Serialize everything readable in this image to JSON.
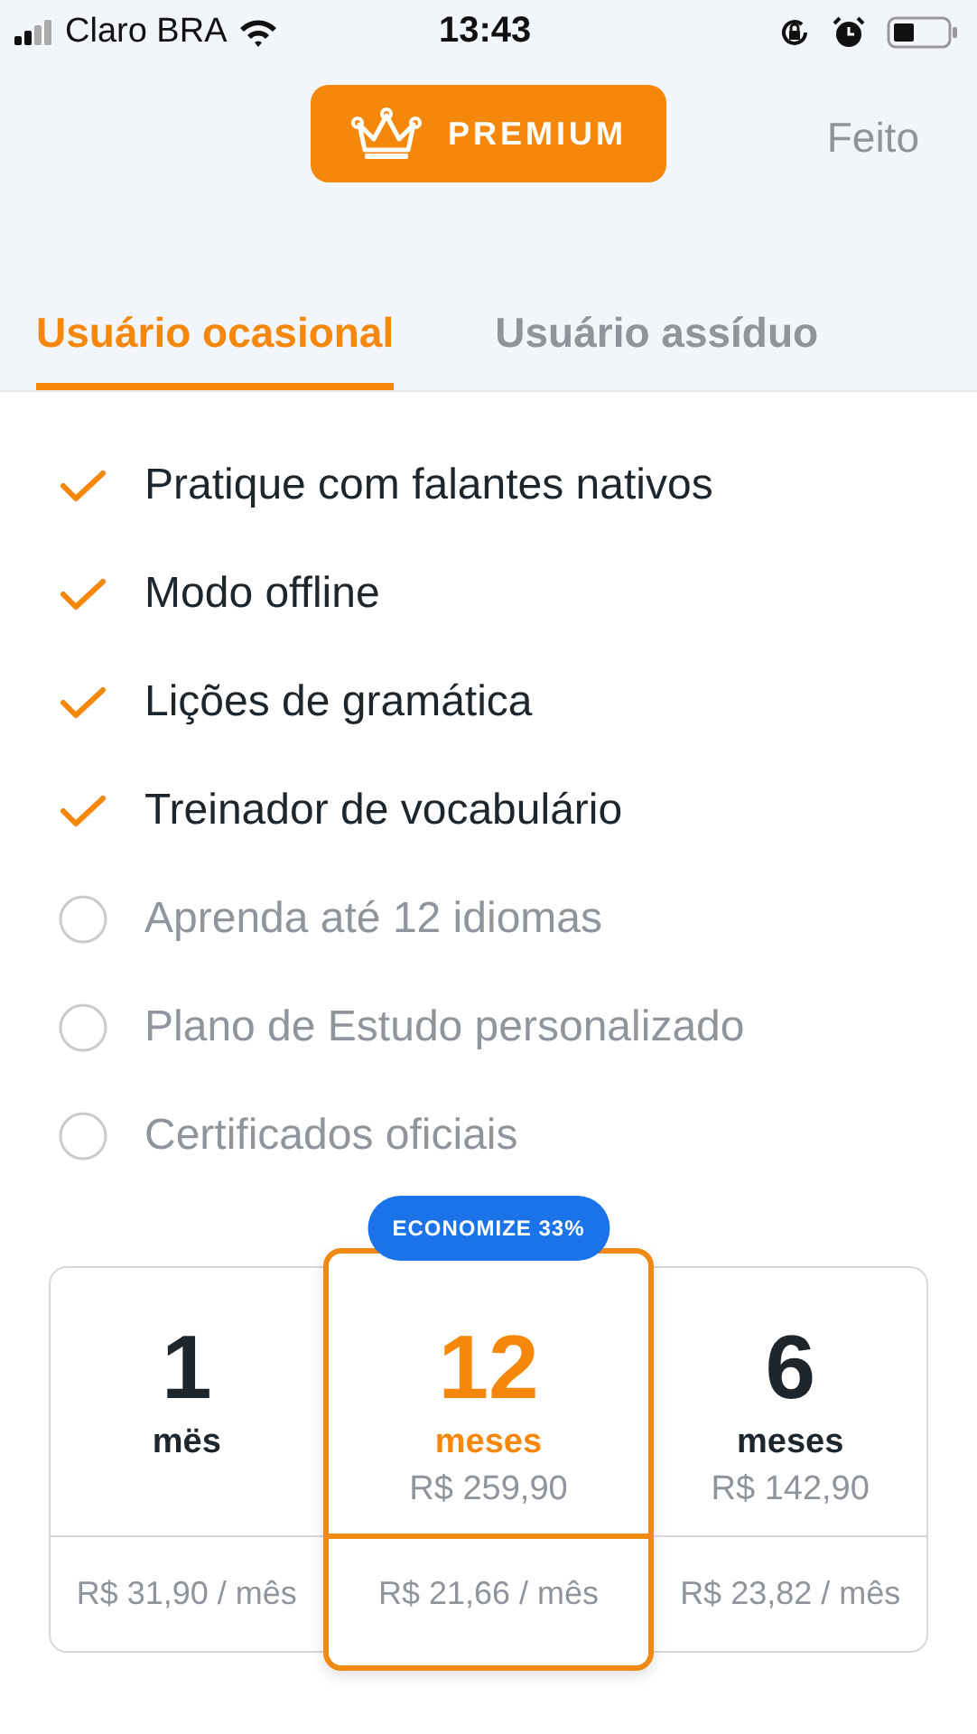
{
  "status_bar": {
    "carrier": "Claro BRA",
    "time": "13:43"
  },
  "header": {
    "premium_label": "PREMIUM",
    "done": "Feito"
  },
  "tabs": [
    {
      "label": "Usuário ocasional",
      "selected": true
    },
    {
      "label": "Usuário assíduo",
      "selected": false
    }
  ],
  "features": [
    {
      "label": "Pratique com falantes nativos",
      "included": true
    },
    {
      "label": "Modo offline",
      "included": true
    },
    {
      "label": "Lições de gramática",
      "included": true
    },
    {
      "label": "Treinador de vocabulário",
      "included": true
    },
    {
      "label": "Aprenda até 12 idiomas",
      "included": false
    },
    {
      "label": "Plano de Estudo personalizado",
      "included": false
    },
    {
      "label": "Certificados oficiais",
      "included": false
    }
  ],
  "plans": [
    {
      "count": "1",
      "unit": "mës",
      "monthly": "R$ 31,90 / mês",
      "selected": false
    },
    {
      "count": "12",
      "unit": "meses",
      "total": "R$ 259,90",
      "monthly": "R$ 21,66 / mês",
      "badge": "ECONOMIZE 33%",
      "selected": true
    },
    {
      "count": "6",
      "unit": "meses",
      "total": "R$ 142,90",
      "monthly": "R$ 23,82 / mês",
      "selected": false
    }
  ]
}
